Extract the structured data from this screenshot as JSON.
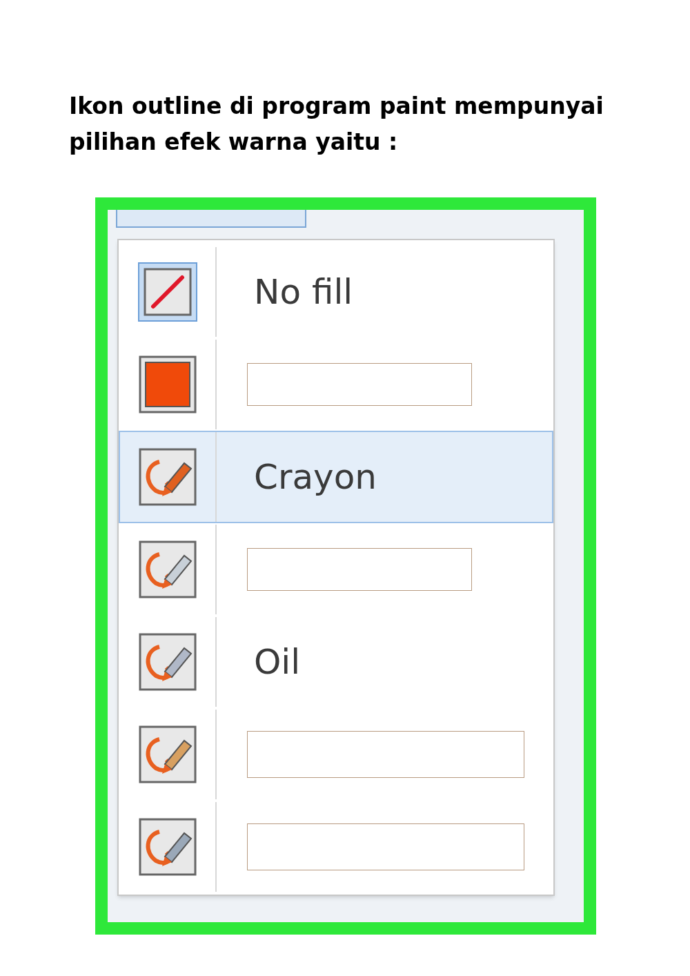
{
  "question": "Ikon outline di program paint mempunyai pilihan efek warna yaitu :",
  "menu": {
    "items": [
      {
        "kind": "no-fill",
        "label": "No fill",
        "blank": false,
        "selected": true,
        "highlighted": false
      },
      {
        "kind": "solid",
        "blank": true,
        "selected": false,
        "highlighted": false
      },
      {
        "kind": "crayon",
        "label": "Crayon",
        "blank": false,
        "selected": false,
        "highlighted": true
      },
      {
        "kind": "marker",
        "blank": true,
        "selected": false,
        "highlighted": false
      },
      {
        "kind": "oil",
        "label": "Oil",
        "blank": false,
        "selected": false,
        "highlighted": false
      },
      {
        "kind": "pencil",
        "blank": true,
        "selected": false,
        "highlighted": false
      },
      {
        "kind": "watercolor",
        "blank": true,
        "selected": false,
        "highlighted": false
      }
    ]
  }
}
